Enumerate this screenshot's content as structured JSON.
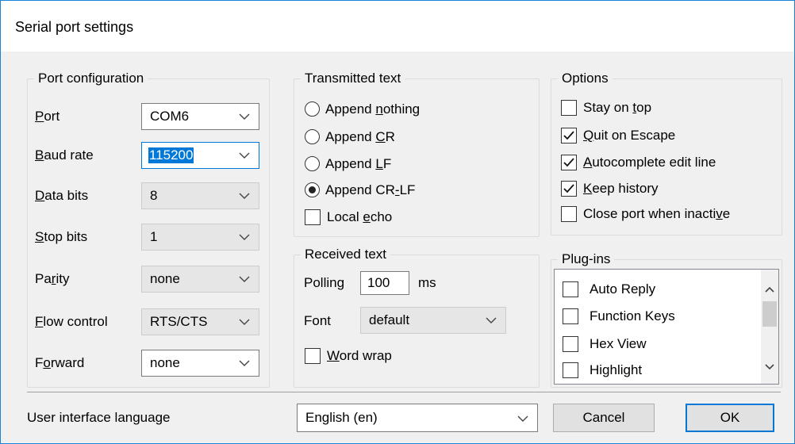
{
  "window": {
    "title": "Serial port settings"
  },
  "port_config": {
    "legend": "Port configuration",
    "rows": [
      {
        "pre": "",
        "u": "P",
        "post": "ort",
        "value": "COM6",
        "enabled": true,
        "focused": false
      },
      {
        "pre": "",
        "u": "B",
        "post": "aud rate",
        "value": "115200",
        "enabled": true,
        "focused": true
      },
      {
        "pre": "",
        "u": "D",
        "post": "ata bits",
        "value": "8",
        "enabled": false,
        "focused": false
      },
      {
        "pre": "",
        "u": "S",
        "post": "top bits",
        "value": "1",
        "enabled": false,
        "focused": false
      },
      {
        "pre": "Pa",
        "u": "r",
        "post": "ity",
        "value": "none",
        "enabled": false,
        "focused": false
      },
      {
        "pre": "",
        "u": "F",
        "post": "low control",
        "value": "RTS/CTS",
        "enabled": false,
        "focused": false
      },
      {
        "pre": "F",
        "u": "o",
        "post": "rward",
        "value": "none",
        "enabled": true,
        "focused": false
      }
    ]
  },
  "transmitted": {
    "legend": "Transmitted text",
    "options": [
      {
        "pre": "Append ",
        "u": "n",
        "post": "othing",
        "selected": false
      },
      {
        "pre": "Append ",
        "u": "C",
        "post": "R",
        "selected": false
      },
      {
        "pre": "Append ",
        "u": "L",
        "post": "F",
        "selected": false
      },
      {
        "pre": "Append CR",
        "u": "-",
        "post": "LF",
        "selected": true
      }
    ],
    "local_echo": {
      "pre": "Local ",
      "u": "e",
      "post": "cho",
      "checked": false
    }
  },
  "received": {
    "legend": "Received text",
    "polling_label": "Polling",
    "polling_value": "100",
    "polling_unit": "ms",
    "font_label": "Font",
    "font_value": "default",
    "word_wrap": {
      "pre": "",
      "u": "W",
      "post": "ord wrap",
      "checked": false
    }
  },
  "options": {
    "legend": "Options",
    "items": [
      {
        "pre": "Stay on ",
        "u": "t",
        "post": "op",
        "checked": false
      },
      {
        "pre": "",
        "u": "Q",
        "post": "uit on Escape",
        "checked": true
      },
      {
        "pre": "",
        "u": "A",
        "post": "utocomplete edit line",
        "checked": true
      },
      {
        "pre": "",
        "u": "K",
        "post": "eep history",
        "checked": true
      },
      {
        "pre": "Close port when inacti",
        "u": "v",
        "post": "e",
        "checked": false
      }
    ]
  },
  "plugins": {
    "legend": "Plug-ins",
    "items": [
      {
        "label": "Auto Reply",
        "checked": false
      },
      {
        "label": "Function Keys",
        "checked": false
      },
      {
        "label": "Hex View",
        "checked": false
      },
      {
        "label": "Highlight",
        "checked": false
      }
    ]
  },
  "footer": {
    "language_label": "User interface language",
    "language_value": "English (en)",
    "cancel_label": "Cancel",
    "ok_label": "OK"
  },
  "icons": {
    "chevron": "chevron-down-icon",
    "check": "check-icon",
    "radio_dot": "radio-dot-icon",
    "scroll_up": "scroll-up-arrow-icon",
    "scroll_down": "scroll-down-arrow-icon"
  },
  "colors": {
    "accent": "#0078d7",
    "window_border": "#1883d7",
    "background": "#f0f0f0"
  }
}
